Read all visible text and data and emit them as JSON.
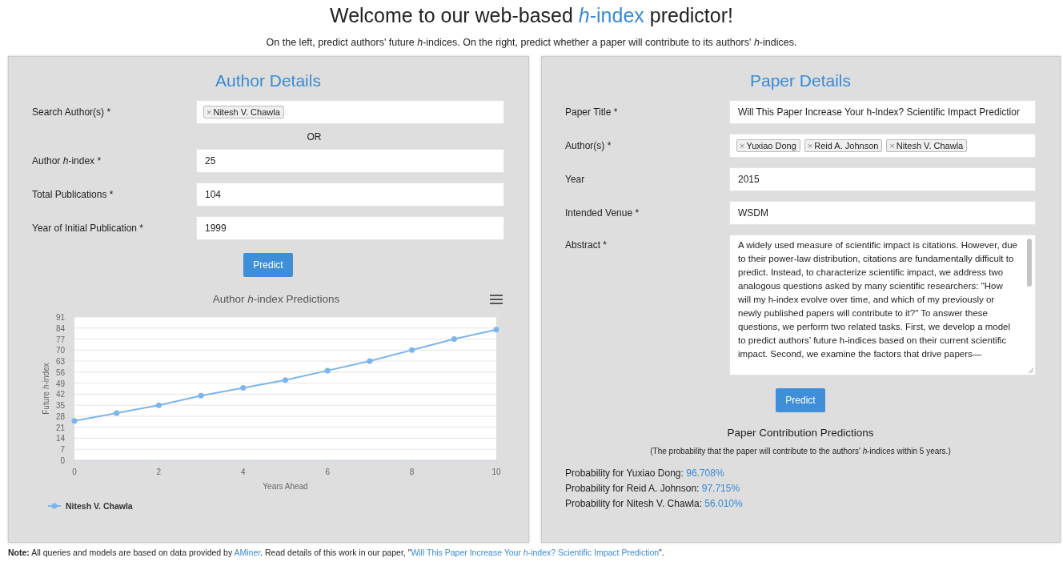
{
  "title": [
    {
      "kind": "text",
      "text": "Welcome to our web-based "
    },
    {
      "kind": "highlight",
      "text": "*h*-index"
    },
    {
      "kind": "text",
      "text": " predictor!"
    }
  ],
  "subtitle": "On the left, predict authors' future *h*-indices. On the right, predict whether a paper will contribute to its authors' *h*-indices.",
  "author_panel": {
    "heading": "Author Details",
    "fields": [
      {
        "kind": "tags",
        "label": "Search Author(s)",
        "mark": "*",
        "tags": [
          {
            "remove": "×",
            "label": "Nitesh V. Chawla"
          }
        ]
      },
      {
        "kind": "separator",
        "text": "OR"
      },
      {
        "kind": "input",
        "label": "Author *h*-index",
        "mark": "*",
        "value": "25"
      },
      {
        "kind": "input",
        "label": "Total Publications",
        "mark": "*",
        "value": "104"
      },
      {
        "kind": "input",
        "label": "Year of Initial Publication",
        "mark": "*",
        "value": "1999"
      }
    ],
    "button": "Predict",
    "chart_data": {
      "type": "line",
      "grid": true,
      "title": "Author *h*-index Predictions",
      "xlabel": "Years Ahead",
      "ylabel": "Future *h*-index",
      "x": [
        0,
        1,
        2,
        3,
        4,
        5,
        6,
        7,
        8,
        9,
        10
      ],
      "xlim": [
        0,
        10
      ],
      "ylim": [
        0,
        91
      ],
      "xticks": [
        0,
        2,
        4,
        6,
        8,
        10
      ],
      "yticks": [
        0,
        7,
        14,
        21,
        28,
        35,
        42,
        49,
        56,
        63,
        70,
        77,
        84,
        91
      ],
      "series": [
        {
          "name": "Nitesh V. Chawla",
          "color": "#7cb5ec",
          "marker": true,
          "values": [
            25,
            30,
            35,
            41,
            46,
            51,
            57,
            63,
            70,
            77,
            83
          ]
        }
      ]
    }
  },
  "paper_panel": {
    "heading": "Paper Details",
    "fields": [
      {
        "kind": "input",
        "label": "Paper Title",
        "mark": "*",
        "value": "Will This Paper Increase Your h-Index? Scientific Impact Predictior"
      },
      {
        "kind": "tags",
        "label": "Author(s)",
        "mark": "*",
        "tags": [
          {
            "remove": "×",
            "label": "Yuxiao Dong"
          },
          {
            "remove": "×",
            "label": "Reid A. Johnson"
          },
          {
            "remove": "×",
            "label": "Nitesh V. Chawla"
          }
        ]
      },
      {
        "kind": "input",
        "label": "Year",
        "value": "2015"
      },
      {
        "kind": "input",
        "label": "Intended Venue",
        "mark": "*",
        "value": "WSDM"
      },
      {
        "kind": "textarea",
        "label": "Abstract",
        "mark": "*",
        "value": "A widely used measure of scientific impact is citations. However, due to their power-law distribution, citations are fundamentally difficult to predict. Instead, to characterize scientific impact, we address two analogous questions asked by many scientific researchers: \"How will my h-index evolve over time, and which of my previously or newly published papers will contribute to it?\" To answer these questions, we perform two related tasks. First, we develop a model to predict authors’ future h-indices based on their current scientific impact. Second, we examine the factors that drive papers—"
      }
    ],
    "button": "Predict",
    "results_heading": "Paper Contribution Predictions",
    "results_note": "(The probability that the paper will contribute to the authors' *h*-indices within 5 years.)",
    "results": [
      {
        "label": "Probability for Yuxiao Dong:",
        "value": "96.708%"
      },
      {
        "label": "Probability for Reid A. Johnson:",
        "value": "97.715%"
      },
      {
        "label": "Probability for Nitesh V. Chawla:",
        "value": "56.010%"
      }
    ]
  },
  "footer": [
    {
      "kind": "text",
      "text": "**Note:** All queries and models are based on data provided by "
    },
    {
      "kind": "link",
      "text": "AMiner"
    },
    {
      "kind": "text",
      "text": ". Read details of this work in our paper, \""
    },
    {
      "kind": "link",
      "text": "Will This Paper Increase Your *h*-index? Scientific Impact Prediction"
    },
    {
      "kind": "text",
      "text": "\"."
    }
  ]
}
